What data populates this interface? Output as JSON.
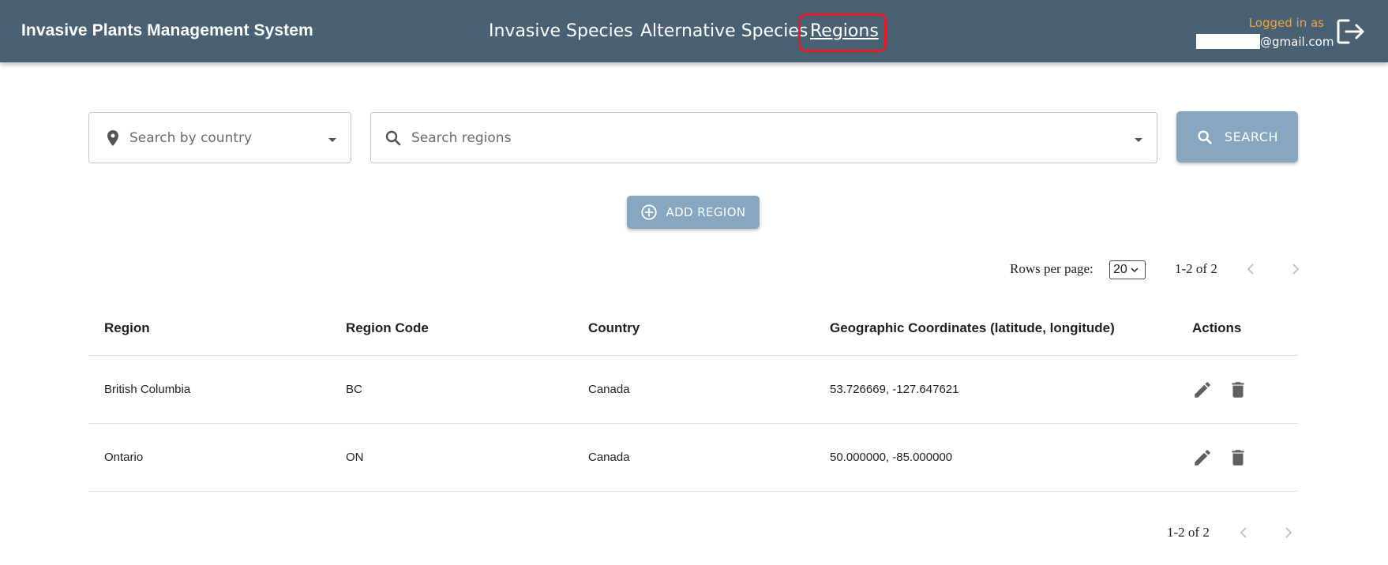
{
  "header": {
    "app_title": "Invasive Plants Management System",
    "nav": [
      {
        "label": "Invasive Species"
      },
      {
        "label": "Alternative Species"
      },
      {
        "label": "Regions"
      }
    ],
    "login_label": "Logged in as",
    "email_suffix": "@gmail.com",
    "logout_icon": "logout-icon"
  },
  "filters": {
    "country_placeholder": "Search by country",
    "region_placeholder": "Search regions",
    "search_label": "SEARCH"
  },
  "add_region_label": "ADD REGION",
  "pagination": {
    "rows_label": "Rows per page:",
    "rows_value": "20",
    "range_text": "1-2 of 2"
  },
  "table": {
    "columns": [
      "Region",
      "Region Code",
      "Country",
      "Geographic Coordinates (latitude, longitude)",
      "Actions"
    ],
    "rows": [
      {
        "region": "British Columbia",
        "code": "BC",
        "country": "Canada",
        "coords": "53.726669, -127.647621"
      },
      {
        "region": "Ontario",
        "code": "ON",
        "country": "Canada",
        "coords": "50.000000, -85.000000"
      }
    ]
  },
  "colors": {
    "header_bg": "#4a6174",
    "button_bg": "#87a6bf",
    "active_outline": "#e31c25",
    "login_label": "#f0a13a"
  }
}
